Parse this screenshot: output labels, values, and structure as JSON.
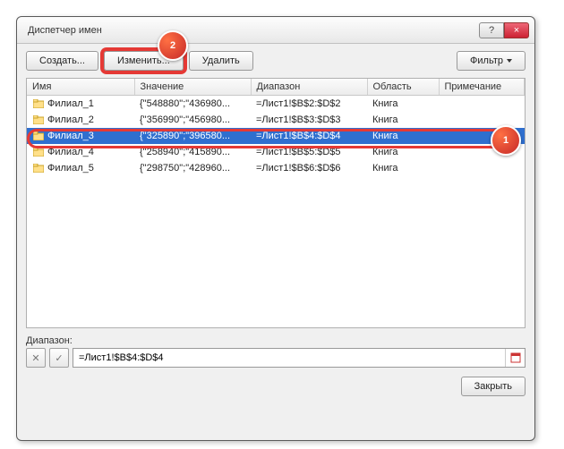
{
  "window": {
    "title": "Диспетчер имен",
    "help_tooltip": "?",
    "close_tooltip": "×"
  },
  "toolbar": {
    "create_label": "Создать...",
    "edit_label": "Изменить...",
    "delete_label": "Удалить",
    "filter_label": "Фильтр"
  },
  "columns": {
    "name": "Имя",
    "value": "Значение",
    "range": "Диапазон",
    "scope": "Область",
    "comment": "Примечание"
  },
  "rows": [
    {
      "name": "Филиал_1",
      "value": "{\"548880\";\"436980...",
      "range": "=Лист1!$B$2:$D$2",
      "scope": "Книга",
      "comment": "",
      "selected": false
    },
    {
      "name": "Филиал_2",
      "value": "{\"356990\";\"456980...",
      "range": "=Лист1!$B$3:$D$3",
      "scope": "Книга",
      "comment": "",
      "selected": false
    },
    {
      "name": "Филиал_3",
      "value": "{\"325890\";\"396580...",
      "range": "=Лист1!$B$4:$D$4",
      "scope": "Книга",
      "comment": "",
      "selected": true
    },
    {
      "name": "Филиал_4",
      "value": "{\"258940\";\"415890...",
      "range": "=Лист1!$B$5:$D$5",
      "scope": "Книга",
      "comment": "",
      "selected": false
    },
    {
      "name": "Филиал_5",
      "value": "{\"298750\";\"428960...",
      "range": "=Лист1!$B$6:$D$6",
      "scope": "Книга",
      "comment": "",
      "selected": false
    }
  ],
  "range_section": {
    "label": "Диапазон:",
    "value": "=Лист1!$B$4:$D$4"
  },
  "footer": {
    "close_label": "Закрыть"
  },
  "callouts": {
    "c1": "1",
    "c2": "2"
  }
}
